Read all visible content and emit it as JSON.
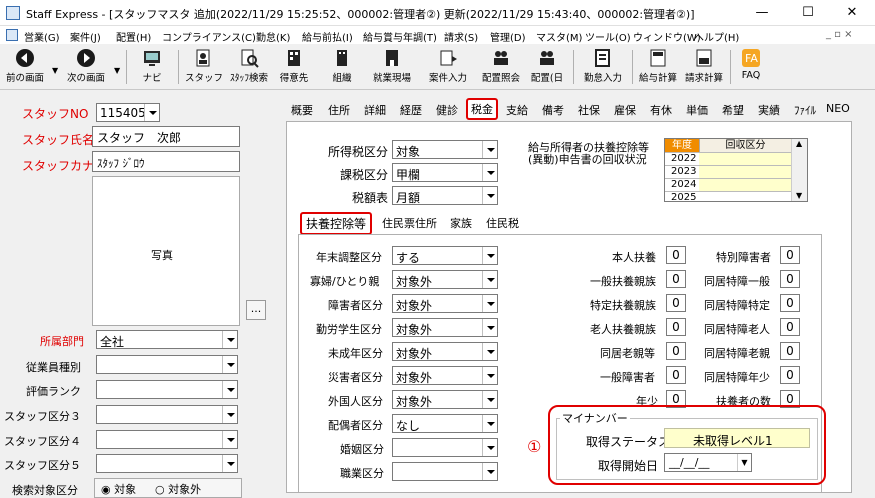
{
  "window": {
    "title": "Staff Express - [スタッフマスタ 追加(2022/11/29 15:25:52、000002:管理者②) 更新(2022/11/29 15:43:40、000002:管理者②)]",
    "minimize": "—",
    "maximize": "☐",
    "close": "✕"
  },
  "menu": {
    "items": [
      "営業(G)",
      "案件(J)",
      "配置(H)",
      "コンプライアンス(C)",
      "勤怠(K)",
      "給与前払(I)",
      "給与賞与年調(T)",
      "請求(S)",
      "管理(D)",
      "マスタ(M)",
      "ツール(O)",
      "ウィンドウ(W)",
      "ヘルプ(H)"
    ],
    "mdi_buttons": "_ ▫ ×"
  },
  "toolbar": {
    "items": [
      "前の画面",
      "次の画面",
      "ナビ",
      "スタッフ",
      "ｽﾀｯﾌ検索",
      "得意先",
      "組織",
      "就業現場",
      "案件入力",
      "配置照会",
      "配置(日",
      "勤怠入力",
      "給与計算",
      "請求計算",
      "FAQ"
    ]
  },
  "left": {
    "staff_no_label": "スタッフNO",
    "staff_no": "115405",
    "staff_name_label": "スタッフ氏名",
    "staff_name": "スタッフ　次郎",
    "staff_kana_label": "スタッフカナ",
    "staff_kana": "ｽﾀｯﾌ ｼﾞﾛｳ",
    "photo_label": "写真",
    "photo_btn": "...",
    "dept_label": "所属部門",
    "dept": "全社",
    "fields": [
      "従業員種別",
      "評価ランク",
      "スタッフ区分３",
      "スタッフ区分４",
      "スタッフ区分５"
    ],
    "search_label": "検索対象区分",
    "radio1": "対象",
    "radio2": "対象外"
  },
  "tabs": {
    "main": [
      "概要",
      "住所",
      "詳細",
      "経歴",
      "健診",
      "税金",
      "支給",
      "備考",
      "社保",
      "雇保",
      "有休",
      "単価",
      "希望",
      "実績",
      "ﾌｧｲﾙ",
      "NEO"
    ],
    "sub": [
      "扶養控除等",
      "住民票住所",
      "家族",
      "住民税"
    ]
  },
  "tax": {
    "rows": [
      {
        "label": "所得税区分",
        "value": "対象"
      },
      {
        "label": "課税区分",
        "value": "甲欄"
      },
      {
        "label": "税額表",
        "value": "月額"
      }
    ],
    "collection_title_1": "給与所得者の扶養控除等",
    "collection_title_2": "(異動)申告書の回収状況",
    "col_year": "年度",
    "col_status": "回収区分",
    "years": [
      "2022",
      "2023",
      "2024",
      "2025"
    ]
  },
  "dependent": {
    "left_rows": [
      {
        "label": "年末調整区分",
        "value": "する"
      },
      {
        "label": "寡婦/ひとり親",
        "value": "対象外"
      },
      {
        "label": "障害者区分",
        "value": "対象外"
      },
      {
        "label": "勤労学生区分",
        "value": "対象外"
      },
      {
        "label": "未成年区分",
        "value": "対象外"
      },
      {
        "label": "災害者区分",
        "value": "対象外"
      },
      {
        "label": "外国人区分",
        "value": "対象外"
      },
      {
        "label": "配偶者区分",
        "value": "なし"
      },
      {
        "label": "婚姻区分",
        "value": ""
      },
      {
        "label": "職業区分",
        "value": ""
      }
    ],
    "mid_rows": [
      {
        "label": "本人扶養",
        "value": "0"
      },
      {
        "label": "一般扶養親族",
        "value": "0"
      },
      {
        "label": "特定扶養親族",
        "value": "0"
      },
      {
        "label": "老人扶養親族",
        "value": "0"
      },
      {
        "label": "同居老親等",
        "value": "0"
      },
      {
        "label": "一般障害者",
        "value": "0"
      },
      {
        "label": "年少",
        "value": "0"
      }
    ],
    "right_rows": [
      {
        "label": "特別障害者",
        "value": "0"
      },
      {
        "label": "同居特障一般",
        "value": "0"
      },
      {
        "label": "同居特障特定",
        "value": "0"
      },
      {
        "label": "同居特障老人",
        "value": "0"
      },
      {
        "label": "同居特障老親",
        "value": "0"
      },
      {
        "label": "同居特障年少",
        "value": "0"
      },
      {
        "label": "扶養者の数",
        "value": "0"
      }
    ]
  },
  "mynumber": {
    "title": "マイナンバー",
    "status_label": "取得ステータス",
    "status": "未取得レベル1",
    "start_label": "取得開始日",
    "start": "__/__/__",
    "marker": "①"
  }
}
